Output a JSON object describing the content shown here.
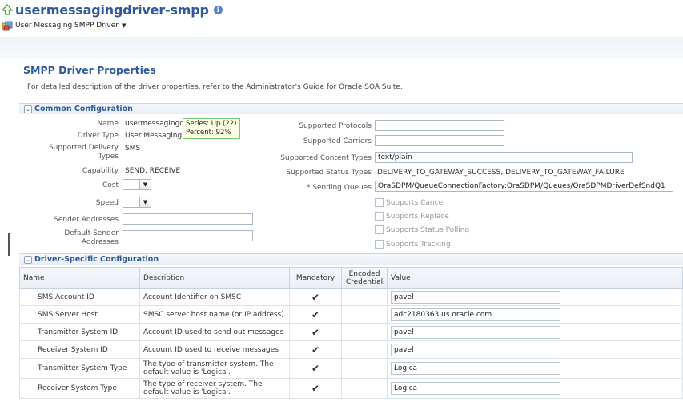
{
  "header": {
    "title": "usermessagingdriver-smpp",
    "menu_label": "User Messaging SMPP Driver"
  },
  "section": {
    "title": "SMPP Driver Properties",
    "description": "For detailed description of the driver properties, refer to the Administrator's Guide for Oracle SOA Suite."
  },
  "common": {
    "heading": "Common Configuration",
    "name_label": "Name",
    "name_value": "usermessagingd",
    "driver_type_label": "Driver Type",
    "driver_type_value": "User Messaging",
    "delivery_types_label": "Supported Delivery Types",
    "delivery_types_value": "SMS",
    "capability_label": "Capability",
    "capability_value": "SEND, RECEIVE",
    "cost_label": "Cost",
    "speed_label": "Speed",
    "sender_addresses_label": "Sender Addresses",
    "default_sender_label": "Default Sender Addresses",
    "protocols_label": "Supported Protocols",
    "carriers_label": "Supported Carriers",
    "content_types_label": "Supported Content Types",
    "content_types_value": "text/plain",
    "status_types_label": "Supported Status Types",
    "status_types_value": "DELIVERY_TO_GATEWAY_SUCCESS, DELIVERY_TO_GATEWAY_FAILURE",
    "sending_queues_label": "* Sending Queues",
    "sending_queues_value": "OraSDPM/QueueConnectionFactory:OraSDPM/Queues/OraSDPMDriverDefSndQ1",
    "checkboxes": [
      "Supports Cancel",
      "Supports Replace",
      "Supports Status Polling",
      "Supports Tracking"
    ]
  },
  "tooltip": {
    "line1": "Series: Up (22)",
    "line2": "Percent: 92%"
  },
  "driver_specific": {
    "heading": "Driver-Specific Configuration",
    "columns": [
      "Name",
      "Description",
      "Mandatory",
      "Encoded Credential",
      "Value"
    ],
    "rows": [
      {
        "name": "SMS Account ID",
        "description": "Account Identifier on SMSC",
        "mandatory": "✔",
        "value": "pavel"
      },
      {
        "name": "SMS Server Host",
        "description": "SMSC server host name (or IP address)",
        "mandatory": "✔",
        "value": "adc2180363.us.oracle.com"
      },
      {
        "name": "Transmitter System ID",
        "description": "Account ID used to send out messages",
        "mandatory": "✔",
        "value": "pavel"
      },
      {
        "name": "Receiver System ID",
        "description": "Account ID used to receive messages",
        "mandatory": "✔",
        "value": "pavel"
      },
      {
        "name": "Transmitter System Type",
        "description": "The type of transmitter system. The default value is 'Logica'.",
        "mandatory": "✔",
        "value": "Logica"
      },
      {
        "name": "Receiver System Type",
        "description": "The type of receiver system. The default value is 'Logica'.",
        "mandatory": "✔",
        "value": "Logica"
      }
    ]
  },
  "colors": {
    "title_blue": "#30599c",
    "tooltip_border": "#6fcf6a"
  }
}
